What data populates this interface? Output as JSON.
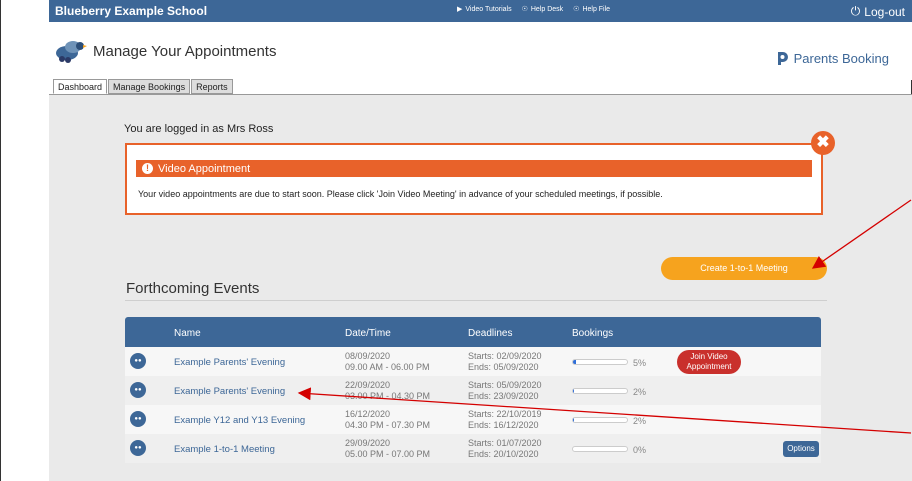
{
  "topbar": {
    "school": "Blueberry Example School",
    "links": [
      {
        "label": "Video Tutorials",
        "icon": "video-camera-icon"
      },
      {
        "label": "Help Desk",
        "icon": "help-icon"
      },
      {
        "label": "Help File",
        "icon": "help-file-icon"
      }
    ],
    "logout": "Log-out"
  },
  "header": {
    "title": "Manage Your Appointments",
    "brand": "Parents Booking"
  },
  "tabs": [
    "Dashboard",
    "Manage Bookings",
    "Reports"
  ],
  "logged_in": "You are logged in as Mrs Ross",
  "alert": {
    "title": "Video Appointment",
    "text": "Your video appointments are due to start soon. Please click 'Join Video Meeting' in advance of your scheduled meetings, if possible."
  },
  "create_button": "Create 1-to-1 Meeting",
  "events": {
    "title": "Forthcoming Events",
    "columns": [
      "Name",
      "Date/Time",
      "Deadlines",
      "Bookings"
    ],
    "rows": [
      {
        "name": "Example Parents' Evening",
        "date": "08/09/2020",
        "time": "09.00 AM - 06.00 PM",
        "starts": "Starts: 02/09/2020",
        "ends": "Ends: 05/09/2020",
        "bookings": "5%",
        "booking_fraction": 0.05,
        "action": "join"
      },
      {
        "name": "Example Parents' Evening",
        "date": "22/09/2020",
        "time": "03.00 PM - 04.30 PM",
        "starts": "Starts: 05/09/2020",
        "ends": "Ends: 23/09/2020",
        "bookings": "2%",
        "booking_fraction": 0.02,
        "action": ""
      },
      {
        "name": "Example Y12 and Y13 Evening",
        "date": "16/12/2020",
        "time": "04.30 PM - 07.30 PM",
        "starts": "Starts: 22/10/2019",
        "ends": "Ends: 16/12/2020",
        "bookings": "2%",
        "booking_fraction": 0.02,
        "action": ""
      },
      {
        "name": "Example 1-to-1 Meeting",
        "date": "29/09/2020",
        "time": "05.00 PM - 07.00 PM",
        "starts": "Starts: 01/07/2020",
        "ends": "Ends: 20/10/2020",
        "bookings": "0%",
        "booking_fraction": 0.0,
        "action": "options"
      }
    ],
    "join_label": "Join Video Appointment",
    "options_label": "Options"
  },
  "colors": {
    "brand_blue": "#3d6797",
    "alert_orange": "#e8622a",
    "create_orange": "#f6a31e",
    "join_red": "#c9302c",
    "annotation_arrow": "#d40000"
  }
}
